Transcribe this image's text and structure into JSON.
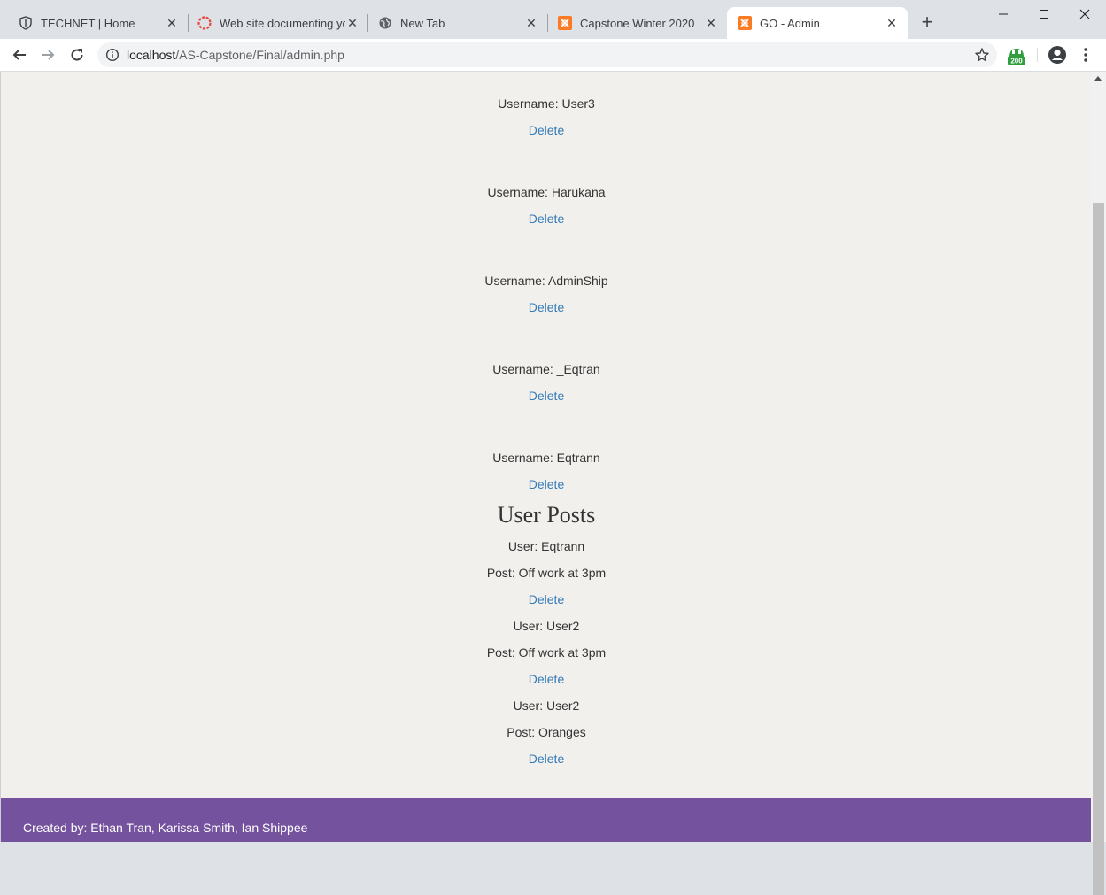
{
  "browser": {
    "tabs": [
      {
        "title": "TECHNET | Home",
        "icon": "shield-icon"
      },
      {
        "title": "Web site documenting yo",
        "icon": "red-ring-icon"
      },
      {
        "title": "New Tab",
        "icon": "globe-icon"
      },
      {
        "title": "Capstone Winter 2020",
        "icon": "xampp-icon"
      },
      {
        "title": "GO - Admin",
        "icon": "xampp-icon",
        "active": true
      }
    ],
    "new_tab_label": "+",
    "url_host": "localhost",
    "url_path": "/AS-Capstone/Final/admin.php",
    "extension_badge": "200"
  },
  "users": [
    {
      "label": "Username: User3",
      "delete": "Delete"
    },
    {
      "label": "Username: Harukana",
      "delete": "Delete"
    },
    {
      "label": "Username: AdminShip",
      "delete": "Delete"
    },
    {
      "label": "Username: _Eqtran",
      "delete": "Delete"
    },
    {
      "label": "Username: Eqtrann",
      "delete": "Delete"
    }
  ],
  "posts_heading": "User Posts",
  "posts": [
    {
      "user": "User: Eqtrann",
      "post": "Post: Off work at 3pm",
      "delete": "Delete"
    },
    {
      "user": "User: User2",
      "post": "Post: Off work at 3pm",
      "delete": "Delete"
    },
    {
      "user": "User: User2",
      "post": "Post: Oranges",
      "delete": "Delete"
    }
  ],
  "footer": {
    "text": "Created by: Ethan Tran, Karissa Smith, Ian Shippee"
  },
  "colors": {
    "footer_bg": "#74529e",
    "link": "#337ab7",
    "page_bg": "#f1f0ed"
  }
}
